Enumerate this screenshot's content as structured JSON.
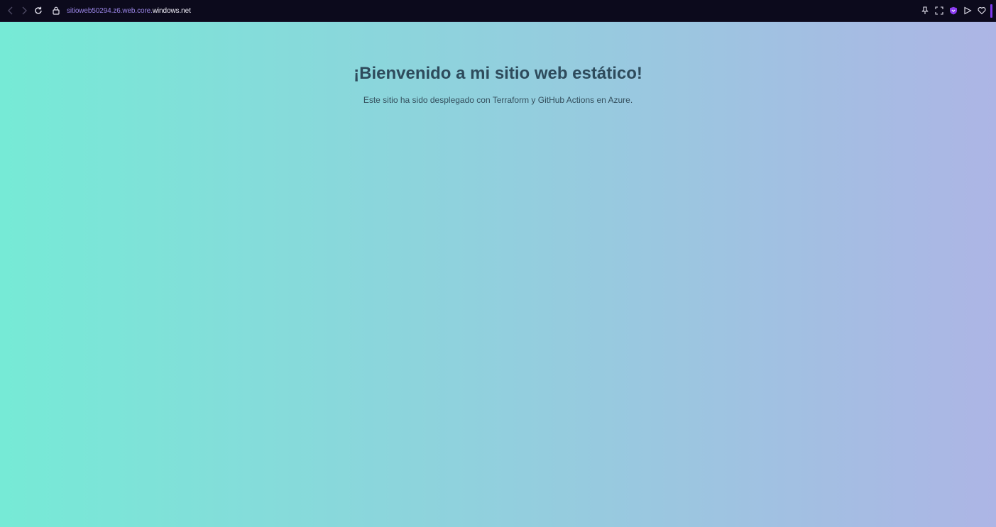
{
  "browser": {
    "url_subdomain": "sitioweb50294.z6.web.core.",
    "url_domain": "windows.net",
    "toolbar_bg": "#0c0a1c",
    "accent_color": "#7c3aed",
    "icons": [
      "back-icon",
      "forward-icon",
      "reload-icon",
      "lock-icon",
      "pin-icon",
      "screenshot-icon",
      "shield-icon",
      "send-icon",
      "heart-icon"
    ]
  },
  "page": {
    "heading": "¡Bienvenido a mi sitio web estático!",
    "subtitle": "Este sitio ha sido desplegado con Terraform y GitHub Actions en Azure.",
    "gradient_start": "#76ead6",
    "gradient_end": "#adb5e5"
  }
}
